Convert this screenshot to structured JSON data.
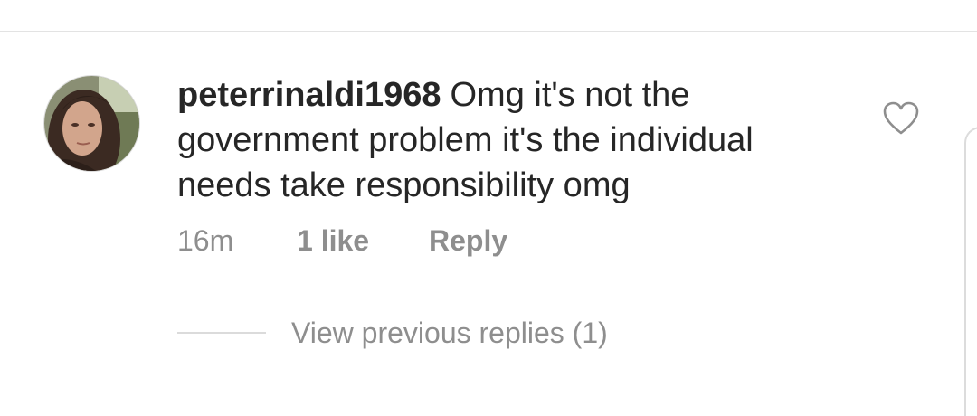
{
  "comment": {
    "username": "peterrinaldi1968",
    "text": "Omg it's not the government problem it's the individual needs take responsibility omg",
    "time": "16m",
    "likes": "1 like",
    "reply_label": "Reply",
    "view_replies_label": "View previous replies (1)",
    "avatar_icon": "profile-photo",
    "like_icon": "heart-outline-icon"
  }
}
